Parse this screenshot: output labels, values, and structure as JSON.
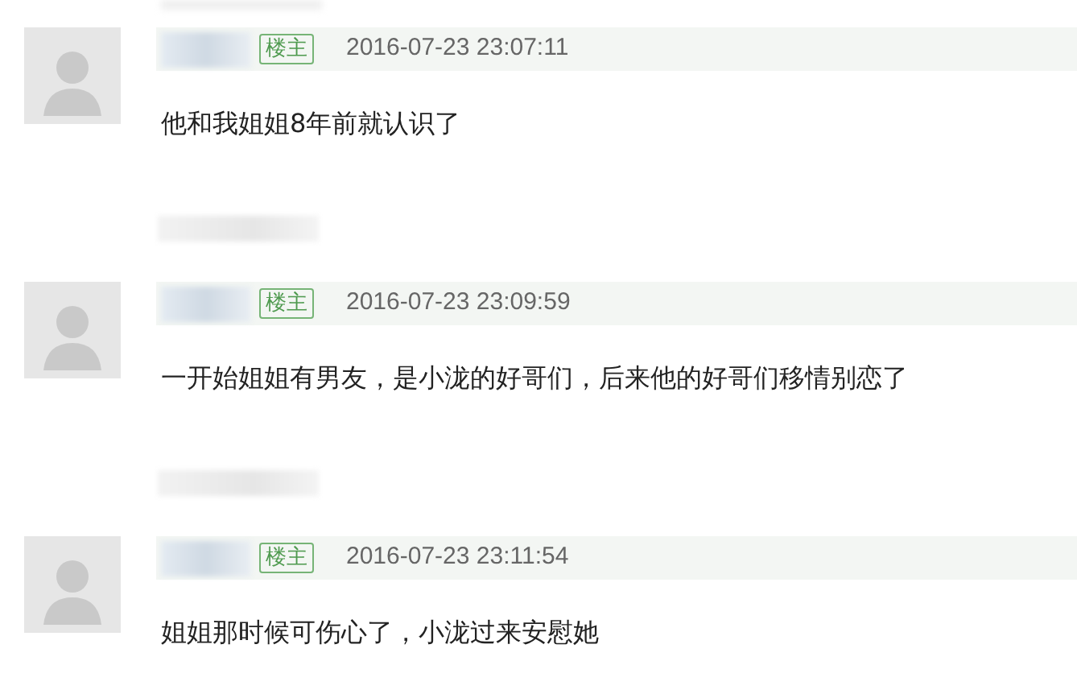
{
  "posts": [
    {
      "badge": "楼主",
      "time": "2016-07-23 23:07:11",
      "content": "他和我姐姐8年前就认识了"
    },
    {
      "badge": "楼主",
      "time": "2016-07-23 23:09:59",
      "content": "一开始姐姐有男友，是小泷的好哥们，后来他的好哥们移情别恋了"
    },
    {
      "badge": "楼主",
      "time": "2016-07-23 23:11:54",
      "content": "姐姐那时候可伤心了，小泷过来安慰她"
    }
  ]
}
